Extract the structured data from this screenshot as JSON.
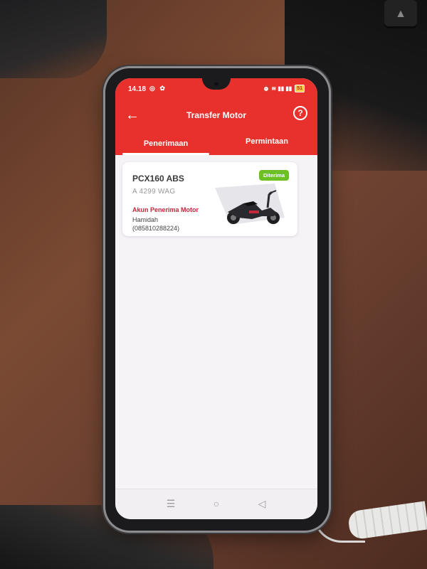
{
  "status_bar": {
    "time": "14.18",
    "left_icons": "◎ ✿",
    "right_icons": "⏰ ≋ ▮▮ ▮▮",
    "battery": "51"
  },
  "app_bar": {
    "title": "Transfer Motor",
    "back_icon": "arrow-left-icon",
    "help_icon": "help-circle-icon",
    "help_glyph": "?"
  },
  "tabs": [
    {
      "label": "Penerimaan",
      "active": true
    },
    {
      "label": "Permintaan",
      "active": false
    }
  ],
  "cards": [
    {
      "model": "PCX160 ABS",
      "plate": "A 4299 WAG",
      "status_badge": "Diterima",
      "receiver_label": "Akun Penerima Motor",
      "receiver_name": "Hamidah",
      "receiver_phone": "(085810288224)"
    }
  ],
  "nav_bar": {
    "menu_glyph": "☰",
    "home_glyph": "○",
    "back_glyph": "◁"
  },
  "colors": {
    "brand": "#e8312c",
    "badge_green": "#6cc024",
    "label_red": "#c4273a"
  }
}
